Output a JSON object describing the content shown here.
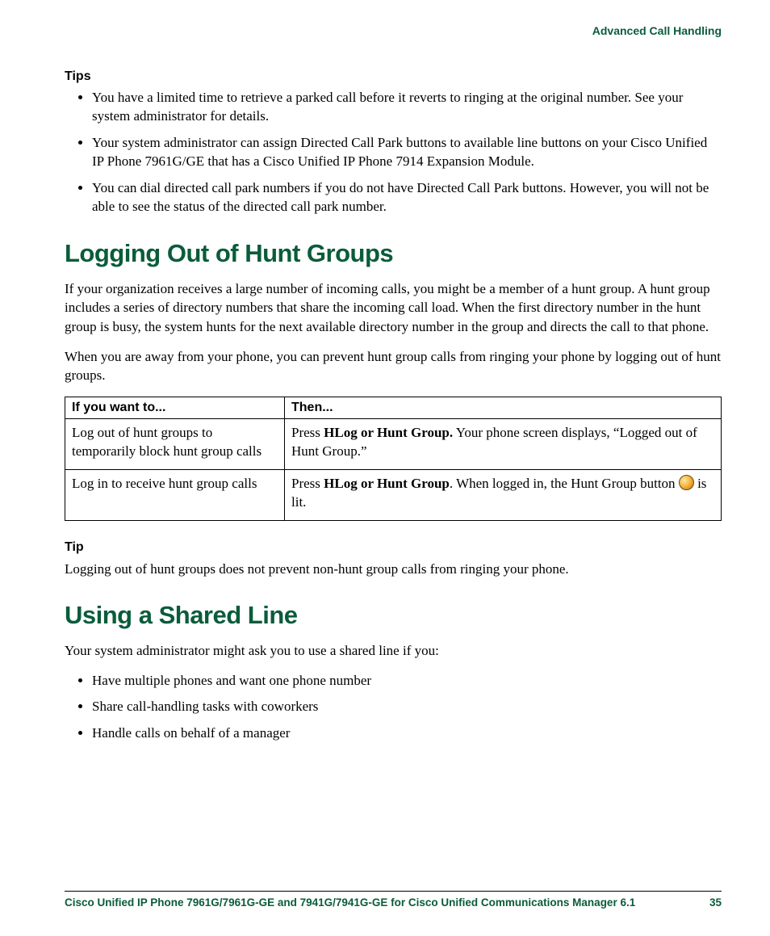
{
  "header": {
    "section": "Advanced Call Handling"
  },
  "tips": {
    "heading": "Tips",
    "items": [
      "You have a limited time to retrieve a parked call before it reverts to ringing at the original number. See your system administrator for details.",
      "Your system administrator can assign Directed Call Park buttons to available line buttons on your Cisco Unified IP Phone 7961G/GE that has a Cisco Unified IP Phone 7914 Expansion Module.",
      "You can dial directed call park numbers if you do not have Directed Call Park buttons. However, you will not be able to see the status of the directed call park number."
    ]
  },
  "hunt": {
    "heading": "Logging Out of Hunt Groups",
    "para1": "If your organization receives a large number of incoming calls, you might be a member of a hunt group. A hunt group includes a series of directory numbers that share the incoming call load. When the first directory number in the hunt group is busy, the system hunts for the next available directory number in the group and directs the call to that phone.",
    "para2": "When you are away from your phone, you can prevent hunt group calls from ringing your phone by logging out of hunt groups.",
    "table": {
      "head_if": "If you want to...",
      "head_then": "Then...",
      "row1_if": "Log out of hunt groups to temporarily block hunt group calls",
      "row1_then_pre": "Press ",
      "row1_then_bold": "HLog or Hunt Group.",
      "row1_then_post": " Your phone screen displays, “Logged out of Hunt Group.”",
      "row2_if": "Log in to receive hunt group calls",
      "row2_then_pre": "Press ",
      "row2_then_bold": "HLog or Hunt Group",
      "row2_then_mid": ". When logged in, the Hunt Group button ",
      "row2_then_post": " is lit."
    }
  },
  "tip": {
    "heading": "Tip",
    "text": "Logging out of hunt groups does not prevent non-hunt group calls from ringing your phone."
  },
  "shared": {
    "heading": "Using a Shared Line",
    "intro": "Your system administrator might ask you to use a shared line if you:",
    "items": [
      "Have multiple phones and want one phone number",
      "Share call-handling tasks with coworkers",
      "Handle calls on behalf of a manager"
    ]
  },
  "footer": {
    "title": "Cisco Unified IP Phone 7961G/7961G-GE and 7941G/7941G-GE for Cisco Unified Communications Manager 6.1",
    "page": "35"
  }
}
